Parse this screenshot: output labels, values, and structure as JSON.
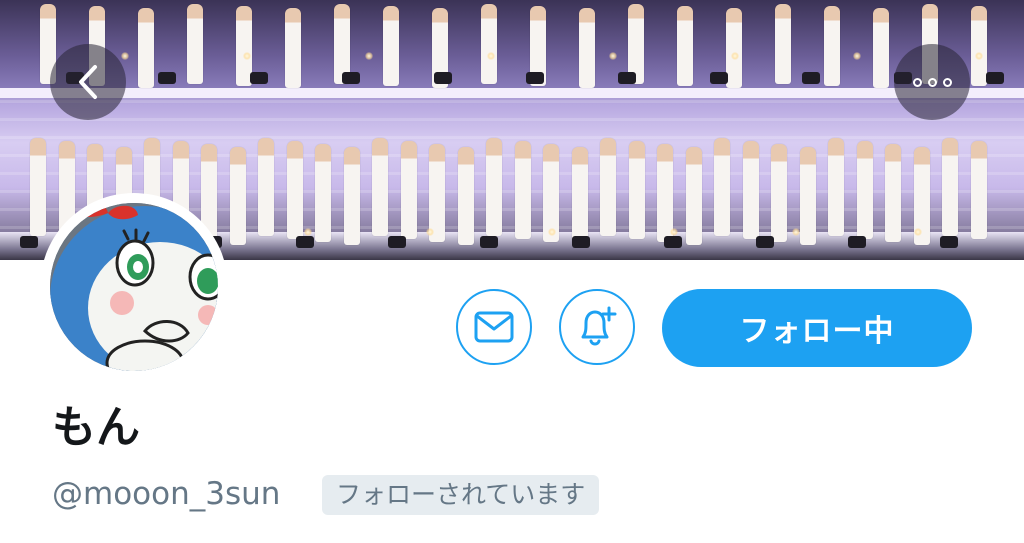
{
  "profile": {
    "display_name": "もん",
    "handle": "@mooon_3sun",
    "follows_you_badge": "フォローされています",
    "follow_button_label": "フォロー中"
  },
  "icons": {
    "back": "chevron-left-icon",
    "more": "more-horizontal-icon",
    "dm": "envelope-icon",
    "notify": "bell-plus-icon"
  },
  "colors": {
    "accent": "#1da1f2",
    "secondary_text": "#657786",
    "badge_bg": "#e6ecf0",
    "primary_text": "#14171a"
  }
}
